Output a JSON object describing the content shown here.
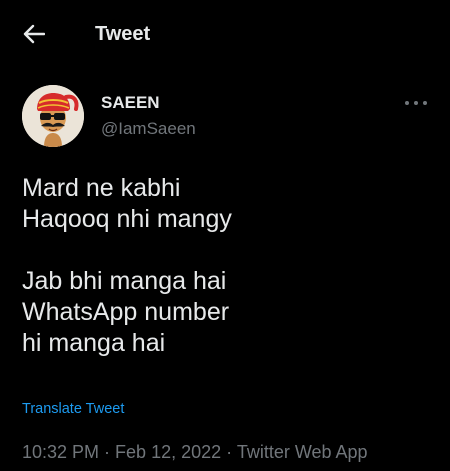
{
  "header": {
    "title": "Tweet",
    "back_icon": "arrow-left-icon"
  },
  "author": {
    "display_name": "SAEEN",
    "handle": "@IamSaeen",
    "avatar_icon": "cartoon-man-with-turban-avatar"
  },
  "more_icon": "more-dots-icon",
  "tweet": {
    "text": "Mard ne kabhi\nHaqooq nhi mangy\n\nJab bhi manga hai\nWhatsApp number\nhi manga hai"
  },
  "translate_label": "Translate Tweet",
  "meta": {
    "time": "10:32 PM",
    "separator": " · ",
    "date": "Feb 12, 2022",
    "source": "Twitter Web App"
  },
  "colors": {
    "background": "#000000",
    "primary_text": "#e7e9ea",
    "secondary_text": "#71767b",
    "accent": "#1d9bf0"
  }
}
